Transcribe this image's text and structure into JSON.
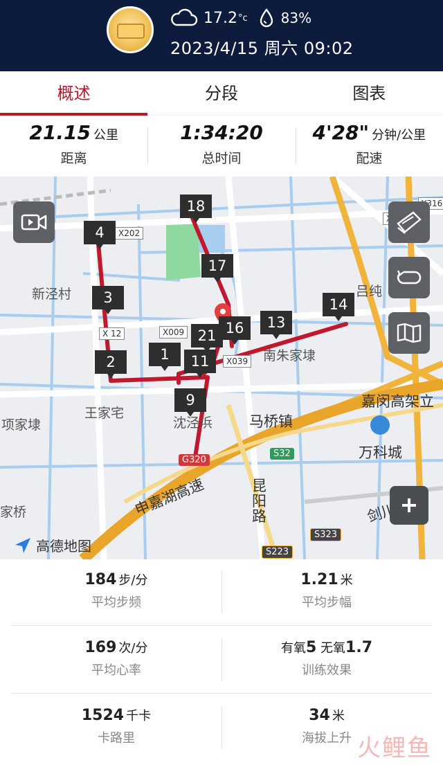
{
  "header": {
    "temperature": "17.2",
    "temp_unit": "°c",
    "humidity": "83%",
    "datetime": "2023/4/15 周六 09:02"
  },
  "tabs": [
    {
      "label": "概述",
      "active": true
    },
    {
      "label": "分段",
      "active": false
    },
    {
      "label": "图表",
      "active": false
    }
  ],
  "summary": {
    "distance": {
      "value": "21.15",
      "unit": "公里",
      "label": "距离"
    },
    "total_time": {
      "value": "1:34:20",
      "unit": "",
      "label": "总时间"
    },
    "pace": {
      "value": "4'28\"",
      "unit": "分钟/公里",
      "label": "配速"
    }
  },
  "map": {
    "km_markers": [
      "1",
      "2",
      "3",
      "4",
      "9",
      "11",
      "13",
      "14",
      "16",
      "17",
      "18",
      "21"
    ],
    "places": {
      "xinjingcun": "新泾村",
      "wangjiazhai": "王家宅",
      "xiangjiadai": "项家埭",
      "jiaqiao": "家桥",
      "shenjingbang": "沈泾浜",
      "nanzhujiadai": "南朱家埭",
      "maqiaozhen": "马桥镇",
      "lvchun": "吕纯",
      "wanke": "万科城",
      "jiamin": "嘉闵高架立",
      "shenjiahu": "申嘉湖高速",
      "kunyanglu": "昆阳路",
      "jianchuan": "剑川"
    },
    "road_badges": {
      "x202": "X202",
      "x12": "X 12",
      "x009": "X009",
      "x039": "X039",
      "x1": "X1",
      "y316": "Y316",
      "g320": "G320",
      "s32": "S32",
      "s323": "S323",
      "s223": "S223"
    },
    "brand": "高德地图",
    "colors": {
      "route": "#c0182f",
      "highway": "#f0b43c",
      "water": "#a8cdee",
      "green": "#8fd9a0"
    }
  },
  "stats": [
    [
      {
        "value": "184",
        "unit": "步/分",
        "label": "平均步频"
      },
      {
        "value": "1.21",
        "unit": "米",
        "label": "平均步幅"
      }
    ],
    [
      {
        "value": "169",
        "unit": "次/分",
        "label": "平均心率"
      },
      {
        "value_prefix1": "有氧",
        "value1": "5",
        "value_prefix2": " 无氧",
        "value2": "1.7",
        "label": "训练效果"
      }
    ],
    [
      {
        "value": "1524",
        "unit": "千卡",
        "label": "卡路里"
      },
      {
        "value": "34",
        "unit": "米",
        "label": "海拔上升"
      }
    ]
  ],
  "watermark": "火鲤鱼"
}
